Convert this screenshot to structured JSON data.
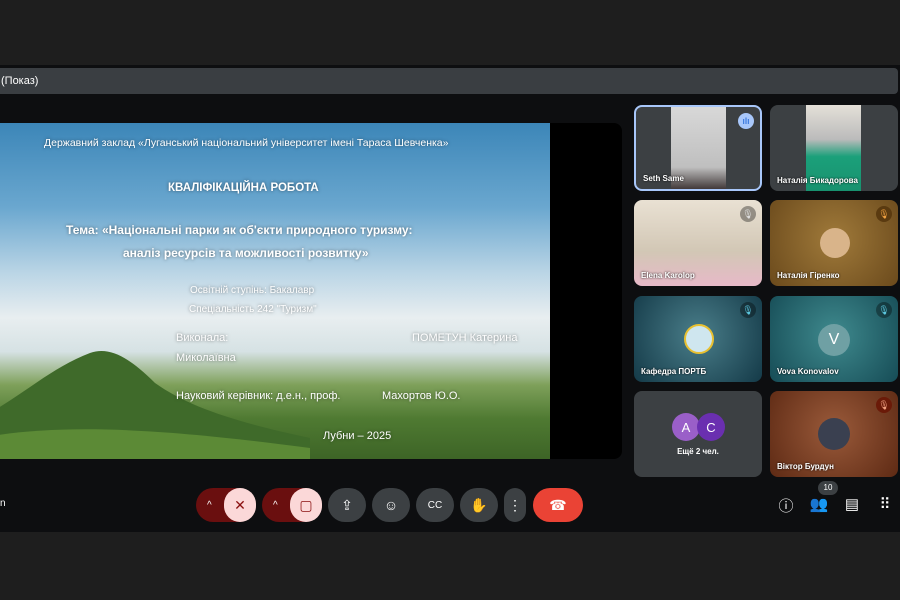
{
  "window": {
    "title": "(Показ)"
  },
  "slide": {
    "institution": "Державний заклад «Луганський національний університет імені Тараса Шевченка»",
    "heading": "КВАЛІФІКАЦІЙНА РОБОТА",
    "topic_line1": "Тема: «Національні парки як об'єкти природного туризму:",
    "topic_line2": "аналіз ресурсів та можливості розвитку»",
    "degree": "Освітній ступінь: Бакалавр",
    "specialty": "Спеціальність 242 \"Туризм\"",
    "performed_label": "Виконала:",
    "author_line1": "ПОМЕТУН Катерина",
    "author_line2": "Миколаївна",
    "supervisor_label": "Науковий керівник: д.е.н., проф.",
    "supervisor": "Махортов Ю.О.",
    "city_year": "Лубни – 2025"
  },
  "participants": [
    {
      "name": "Seth Same",
      "speaking": true
    },
    {
      "name": "Наталія Бикадорова"
    },
    {
      "name": "Elena Karolop",
      "muted": true
    },
    {
      "name": "Наталія Гіренко",
      "muted": true
    },
    {
      "name": "Кафедра ПОРТБ",
      "muted": true
    },
    {
      "name": "Vova Konovalov",
      "initial": "V",
      "muted": true
    },
    {
      "name": "Ещё 2 чел.",
      "initials": [
        "A",
        "C"
      ]
    },
    {
      "name": "Віктор Бурдун",
      "muted": true
    }
  ],
  "controls": {
    "left_text": "n",
    "participant_count": "10"
  }
}
